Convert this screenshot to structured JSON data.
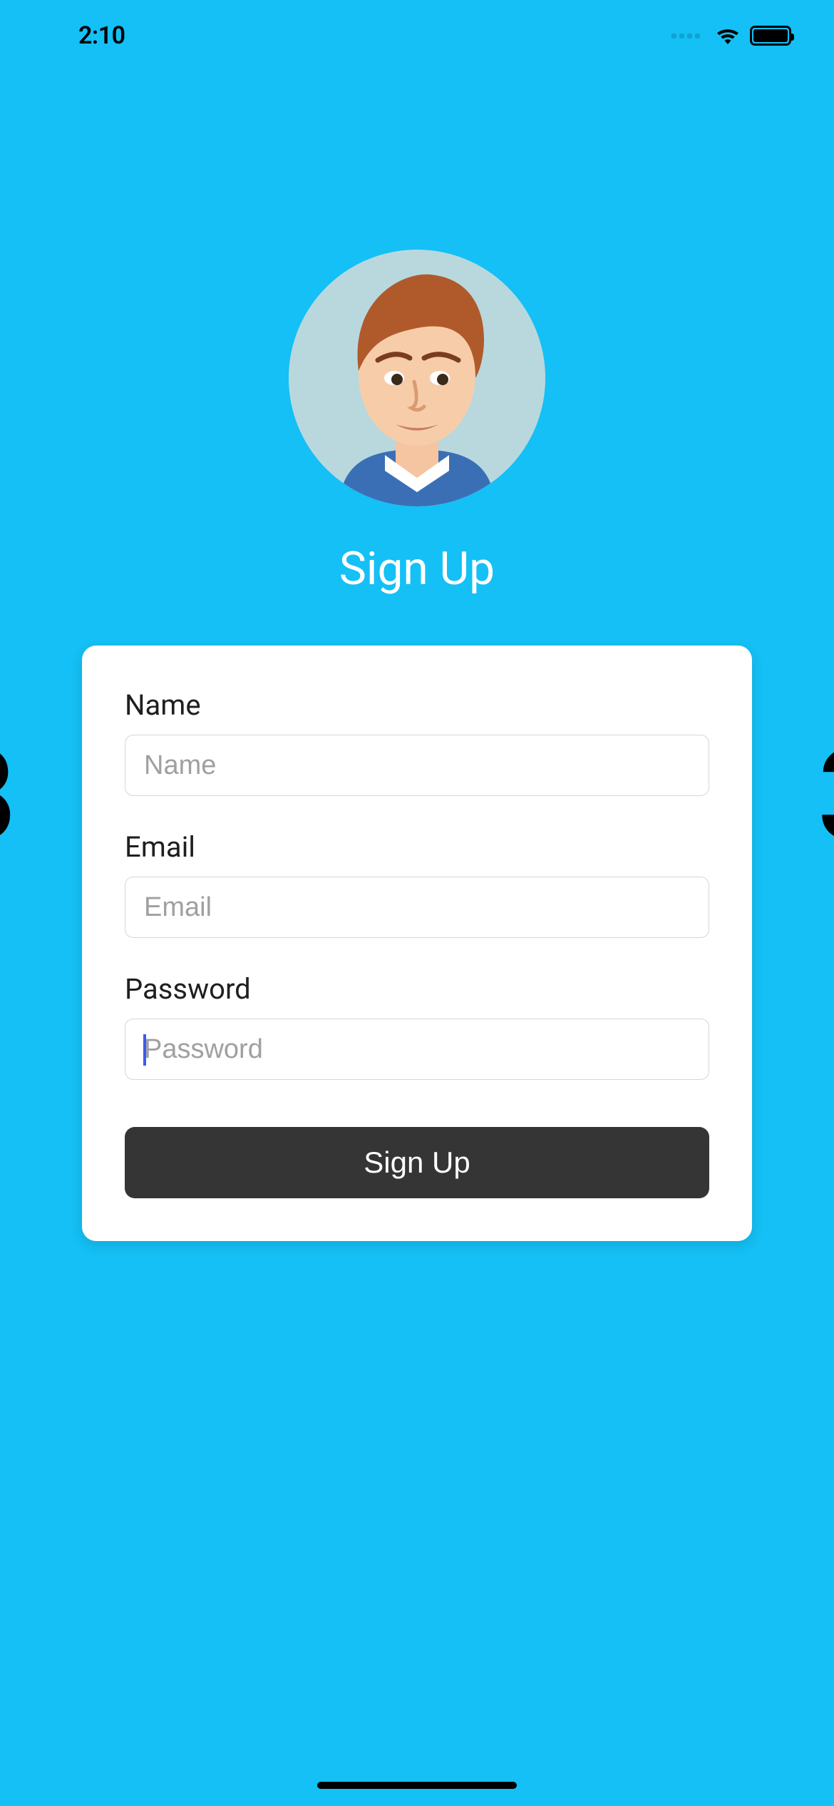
{
  "status": {
    "time": "2:10"
  },
  "title": "Sign Up",
  "form": {
    "name": {
      "label": "Name",
      "placeholder": "Name",
      "value": ""
    },
    "email": {
      "label": "Email",
      "placeholder": "Email",
      "value": ""
    },
    "password": {
      "label": "Password",
      "placeholder": "Password",
      "value": ""
    },
    "submit_label": "Sign Up"
  }
}
